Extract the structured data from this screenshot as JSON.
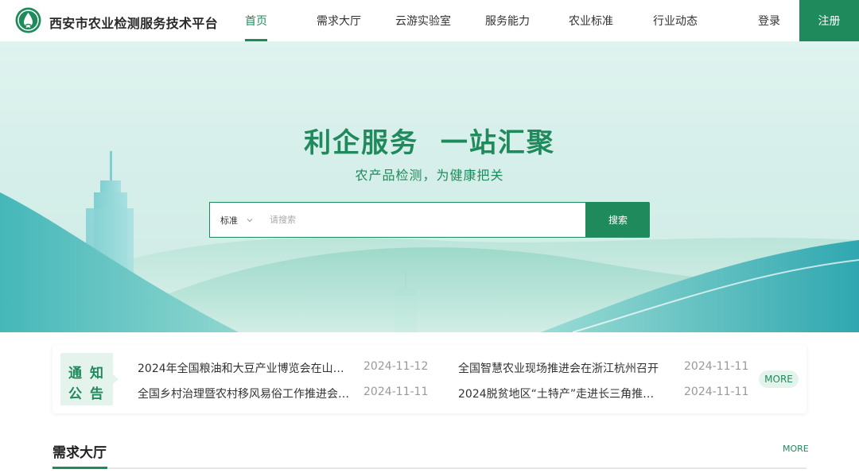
{
  "header": {
    "site_title": "西安市农业检测服务技术平台",
    "nav": [
      {
        "label": "首页",
        "active": true
      },
      {
        "label": "需求大厅"
      },
      {
        "label": "云游实验室"
      },
      {
        "label": "服务能力"
      },
      {
        "label": "农业标准"
      },
      {
        "label": "行业动态"
      }
    ],
    "login_label": "登录",
    "register_label": "注册"
  },
  "hero": {
    "title": "利企服务  一站汇聚",
    "subtitle": "农产品检测，为健康把关",
    "search": {
      "category": "标准",
      "placeholder": "请搜索",
      "value": "",
      "button_label": "搜索"
    }
  },
  "notice": {
    "badge_chars": [
      "通",
      "知",
      "公",
      "告"
    ],
    "items": [
      {
        "title": "2024年全国粮油和大豆产业博览会在山…",
        "date": "2024-11-12"
      },
      {
        "title": "全国智慧农业现场推进会在浙江杭州召开",
        "date": "2024-11-11"
      },
      {
        "title": "全国乡村治理暨农村移风易俗工作推进会…",
        "date": "2024-11-11"
      },
      {
        "title": "2024脱贫地区“土特产”走进长三角推…",
        "date": "2024-11-11"
      }
    ],
    "more_label": "MORE"
  },
  "section": {
    "title": "需求大厅",
    "more_label": "MORE"
  },
  "colors": {
    "primary": "#1f8a5b",
    "accent_light": "#e4f4ec",
    "hero_bg": "#d6efea",
    "teal": "#3ab4b0"
  },
  "icons": {
    "logo": "leaf-drop-logo-icon",
    "select_chevron": "chevron-down-icon"
  }
}
